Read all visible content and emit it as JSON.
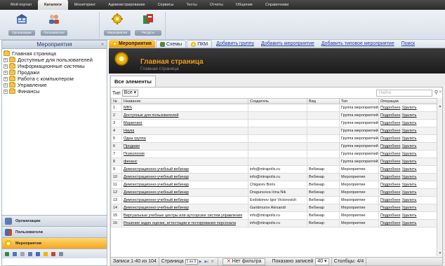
{
  "menubar": {
    "items": [
      {
        "label": "Мой портал",
        "active": false
      },
      {
        "label": "Каталоги",
        "active": true
      },
      {
        "label": "Мониторинг",
        "active": false
      },
      {
        "label": "Администрирование",
        "active": false
      },
      {
        "label": "Сервисы",
        "active": false
      },
      {
        "label": "Тесты",
        "active": false
      },
      {
        "label": "Отчеты",
        "active": false
      },
      {
        "label": "Общение",
        "active": false
      },
      {
        "label": "Справочники",
        "active": false
      }
    ]
  },
  "toolbar": {
    "buttons": [
      {
        "label": "Организации",
        "icon": "org-chart-icon"
      },
      {
        "label": "Пользователи",
        "icon": "users-icon"
      },
      {
        "label": "Мероприятия",
        "icon": "gear-icon"
      },
      {
        "label": "Ресурсы",
        "icon": "resources-icon"
      }
    ]
  },
  "leftpanel": {
    "title": "Мероприятия",
    "collapse_label": "«",
    "tree": [
      {
        "label": "Главная страница",
        "expander": ""
      },
      {
        "label": "Доступные для пользователей",
        "expander": "+"
      },
      {
        "label": "Информационные системы",
        "expander": "+"
      },
      {
        "label": "Продажи",
        "expander": "+"
      },
      {
        "label": "Работа с компьютером",
        "expander": "+"
      },
      {
        "label": "Управление",
        "expander": "+"
      },
      {
        "label": "Финансы",
        "expander": "+"
      }
    ],
    "accordion": [
      {
        "label": "Организации",
        "active": false
      },
      {
        "label": "Пользователи",
        "active": false
      },
      {
        "label": "Мероприятия",
        "active": true
      }
    ]
  },
  "tabs": [
    {
      "label": "Мероприятия",
      "active": true
    },
    {
      "label": "Схемы",
      "active": false
    },
    {
      "label": "ПКМ",
      "active": false
    }
  ],
  "tab_links": [
    "Добавить группу",
    "Добавить мероприятие",
    "Добавить типовое мероприятие",
    "Поиск"
  ],
  "page_header": {
    "title": "Главная страница",
    "breadcrumb": "Главная страница"
  },
  "content": {
    "subtab": "Все элементы",
    "filter": {
      "label": "Тип",
      "value": "Все ▾"
    },
    "search": {
      "placeholder": "Найти"
    },
    "columns": [
      "№",
      "Название",
      "Создатель",
      "Вид",
      "Тип",
      "Операции"
    ],
    "rows": [
      {
        "num": "1",
        "name": "MBS",
        "creator": "",
        "kind": "",
        "type": "Группа мероприятий",
        "op1": "Подробнее",
        "op2": "Удалить"
      },
      {
        "num": "2",
        "name": "Доступные для пользователей",
        "creator": "",
        "kind": "",
        "type": "Группа мероприятий",
        "op1": "Подробнее",
        "op2": "Удалить"
      },
      {
        "num": "3",
        "name": "Маркетинг",
        "creator": "",
        "kind": "",
        "type": "Группа мероприятий",
        "op1": "Подробнее",
        "op2": "Удалить"
      },
      {
        "num": "4",
        "name": "Наука",
        "creator": "",
        "kind": "",
        "type": "Группа мероприятий",
        "op1": "Подробнее",
        "op2": "Удалить"
      },
      {
        "num": "5",
        "name": "Одна группа",
        "creator": "",
        "kind": "",
        "type": "Группа мероприятий",
        "op1": "Подробнее",
        "op2": "Удалить"
      },
      {
        "num": "6",
        "name": "Продажи",
        "creator": "",
        "kind": "",
        "type": "Группа мероприятий",
        "op1": "Подробнее",
        "op2": "Удалить"
      },
      {
        "num": "7",
        "name": "Психология",
        "creator": "",
        "kind": "",
        "type": "Группа мероприятий",
        "op1": "Подробнее",
        "op2": "Удалить"
      },
      {
        "num": "8",
        "name": "финанс",
        "creator": "",
        "kind": "",
        "type": "Группа мероприятий",
        "op1": "Подробнее",
        "op2": "Удалить"
      },
      {
        "num": "9",
        "name": "Демонстрационно-учебный вебинар",
        "creator": "info@mirapolis.ru",
        "kind": "Вебинар",
        "type": "Мероприятие",
        "op1": "Подробнее",
        "op2": "Удалить"
      },
      {
        "num": "10",
        "name": "Демонстрационно-учебный вебинар",
        "creator": "info@mirapolis.ru",
        "kind": "Вебинар",
        "type": "Мероприятие",
        "op1": "Подробнее",
        "op2": "Удалить"
      },
      {
        "num": "11",
        "name": "Демонстрационно-учебный вебинар",
        "creator": "Chigarev Boris",
        "kind": "Вебинар",
        "type": "Мероприятие",
        "op1": "Подробнее",
        "op2": "Удалить"
      },
      {
        "num": "12",
        "name": "Демонстрационно-учебный вебинар",
        "creator": "Dragunsova Irina Nik",
        "kind": "Вебинар",
        "type": "Мероприятие",
        "op1": "Подробнее",
        "op2": "Удалить"
      },
      {
        "num": "13",
        "name": "Демонстрационно-учебный вебинар",
        "creator": "Evdokimov Igor Victorovich",
        "kind": "Вебинар",
        "type": "Мероприятие",
        "op1": "Подробнее",
        "op2": "Удалить"
      },
      {
        "num": "14",
        "name": "Демонстрационно-учебный вебинар",
        "creator": "Gantimurov Alexandr",
        "kind": "Вебинар",
        "type": "Мероприятие",
        "op1": "Подробнее",
        "op2": "Удалить"
      },
      {
        "num": "15",
        "name": "Виртуальные учебные центры или аутсорсинг систем управления",
        "creator": "info@mirapolis.ru",
        "kind": "Вебинар",
        "type": "Мероприятие",
        "op1": "Подробнее",
        "op2": "Удалить"
      },
      {
        "num": "16",
        "name": "Решение задач оценки, аттестации и тестирования персонала",
        "creator": "info@mirapolis.ru",
        "kind": "Вебинар",
        "type": "Мероприятие",
        "op1": "Подробнее",
        "op2": "Удалить"
      }
    ],
    "pager": {
      "records": "Записи 1-40 из 104",
      "page_label": "Страница",
      "page_value": "1 из 3",
      "no_filter": "Нет фильтра",
      "shown_label": "Показано записей",
      "shown_value": "40 ▾",
      "columns_label": "Столбцы: 4/4"
    }
  },
  "colors": {
    "accent_orange": "#f39c12",
    "menubar_dark": "#2a2a2a",
    "link_blue": "#1a3e9c"
  }
}
